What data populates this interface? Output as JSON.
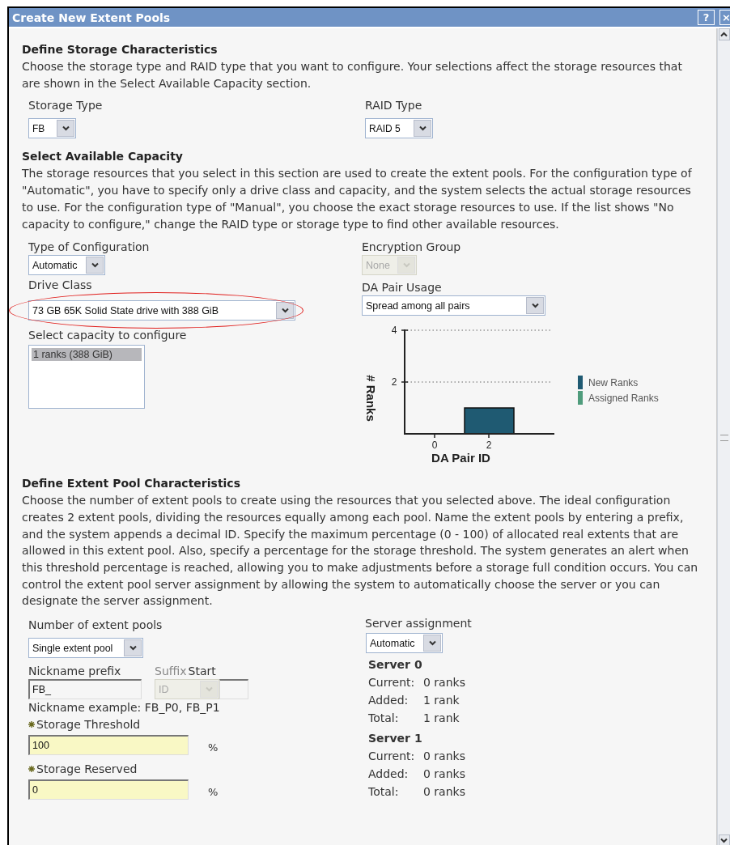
{
  "window": {
    "title": "Create New Extent Pools",
    "help_button": "?",
    "close_button": "×"
  },
  "storage_characteristics": {
    "heading": "Define Storage Characteristics",
    "description": "Choose the storage type and RAID type that you want to configure. Your selections affect the storage resources that are shown in the Select Available Capacity section.",
    "storage_type": {
      "label": "Storage Type",
      "value": "FB"
    },
    "raid_type": {
      "label": "RAID Type",
      "value": "RAID 5"
    }
  },
  "available_capacity": {
    "heading": "Select Available Capacity",
    "description": "The storage resources that you select in this section are used to create the extent pools. For the configuration type of \"Automatic\", you have to specify only a drive class and capacity, and the system selects the actual storage resources to use. For the configuration type of \"Manual\", you choose the exact storage resources to use. If the list shows \"No capacity to configure,\" change the RAID type or storage type to find other available resources.",
    "configuration_type": {
      "label": "Type of Configuration",
      "value": "Automatic"
    },
    "encryption_group": {
      "label": "Encryption Group",
      "value": "None",
      "disabled": true
    },
    "drive_class": {
      "label": "Drive Class",
      "value": "73 GB 65K Solid State drive with 388 GiB",
      "circled": true
    },
    "da_pair_usage": {
      "label": "DA Pair Usage",
      "value": "Spread among all pairs"
    },
    "capacity_list": {
      "label": "Select capacity to configure",
      "items": [
        {
          "text": "1 ranks (388 GiB)",
          "selected": true
        }
      ]
    },
    "chart_data": {
      "type": "bar",
      "xlabel": "DA Pair ID",
      "ylabel": "# Ranks",
      "categories": [
        "0",
        "2"
      ],
      "ylim": [
        0,
        4
      ],
      "yticks": [
        2,
        4
      ],
      "stacked": true,
      "series": [
        {
          "name": "New Ranks",
          "color": "#1f5a72",
          "values": [
            null,
            1
          ]
        },
        {
          "name": "Assigned Ranks",
          "color": "#4f9c7c",
          "values": [
            null,
            null
          ]
        }
      ]
    }
  },
  "extent_pool_characteristics": {
    "heading": "Define Extent Pool Characteristics",
    "description": "Choose the number of extent pools to create using the resources that you selected above. The ideal configuration creates 2 extent pools, dividing the resources equally among each pool. Name the extent pools by entering a prefix, and the system appends a decimal ID. Specify the maximum percentage (0 - 100) of allocated real extents that are allowed in this extent pool. Also, specify a percentage for the storage threshold. The system generates an alert when this threshold percentage is reached, allowing you to make adjustments before a storage full condition occurs. You can control the extent pool server assignment by allowing the system to automatically choose the server or you can designate the server assignment.",
    "number_of_pools": {
      "label": "Number of extent pools",
      "value": "Single extent pool"
    },
    "nickname_prefix": {
      "label": "Nickname prefix",
      "value": "FB_"
    },
    "suffix_start": {
      "suffix_label": "Suffix",
      "start_label": "Start",
      "value": "ID",
      "disabled": true
    },
    "nickname_example": "Nickname example: FB_P0, FB_P1",
    "storage_threshold": {
      "label": "Storage Threshold",
      "value": "100",
      "unit": "%",
      "required": true
    },
    "storage_reserved": {
      "label": "Storage Reserved",
      "value": "0",
      "unit": "%",
      "required": true
    },
    "server_assignment": {
      "label": "Server assignment",
      "value": "Automatic"
    },
    "servers": [
      {
        "name": "Server 0",
        "rows": [
          {
            "label": "Current:",
            "value": "0 ranks"
          },
          {
            "label": "Added:",
            "value": "1 rank"
          },
          {
            "label": "Total:",
            "value": "1 rank"
          }
        ]
      },
      {
        "name": "Server 1",
        "rows": [
          {
            "label": "Current:",
            "value": "0 ranks"
          },
          {
            "label": "Added:",
            "value": "0 ranks"
          },
          {
            "label": "Total:",
            "value": "0 ranks"
          }
        ]
      }
    ]
  }
}
